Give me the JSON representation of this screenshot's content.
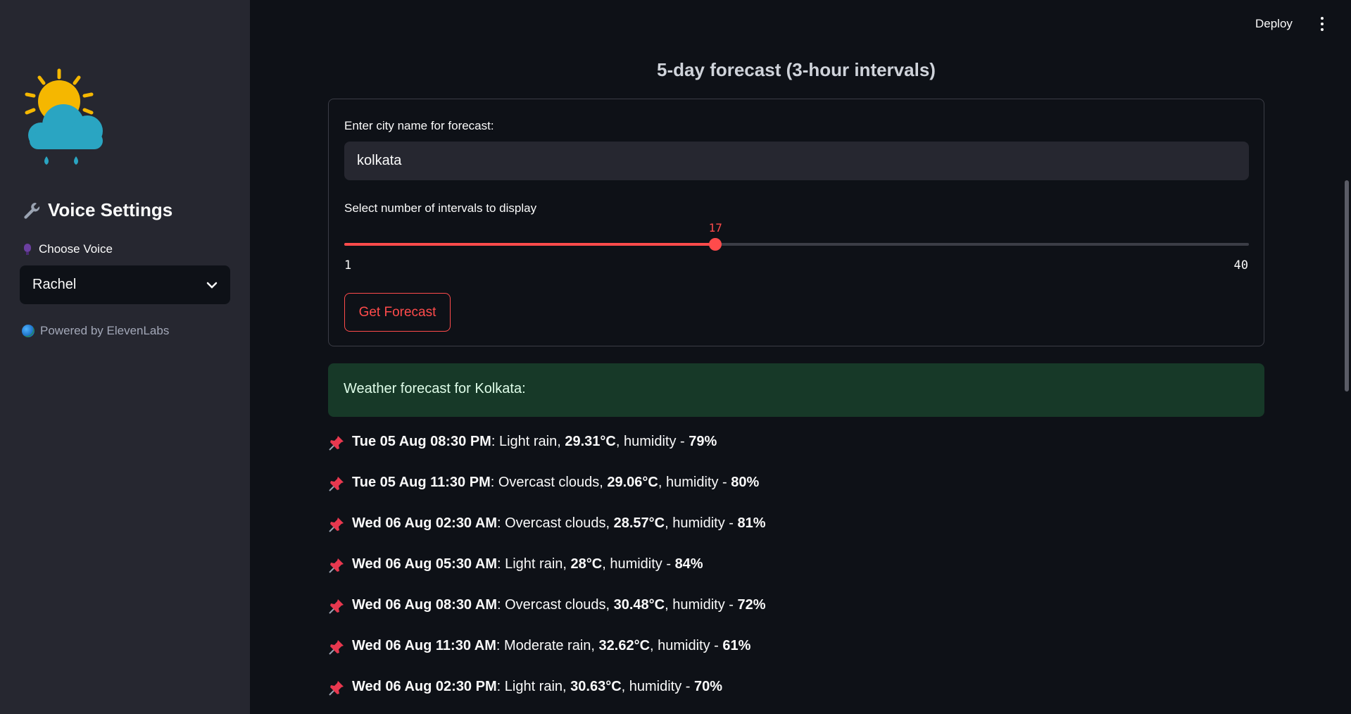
{
  "header": {
    "deploy_label": "Deploy",
    "menu_icon": "kebab-menu-icon"
  },
  "sidebar": {
    "logo_icon": "weather-rain-cloud-sun-icon",
    "heading": "Voice Settings",
    "heading_icon": "wrench-icon",
    "choose_voice_label": "Choose Voice",
    "choose_voice_icon": "microphone-icon",
    "voice_selected": "Rachel",
    "powered_by": "Powered by ElevenLabs",
    "powered_icon": "globe-icon"
  },
  "main": {
    "title": "5-day forecast (3-hour intervals)",
    "city_label": "Enter city name for forecast:",
    "city_value": "kolkata",
    "interval_label": "Select number of intervals to display",
    "interval_value": "17",
    "interval_min": "1",
    "interval_max": "40",
    "interval_fraction": 0.4103,
    "button_label": "Get Forecast",
    "success_message": "Weather forecast for Kolkata:",
    "pin_icon": "pushpin-icon",
    "forecast": [
      {
        "time": "Tue 05 Aug 08:30 PM",
        "desc": "Light rain",
        "temp": "29.31°C",
        "humidity": "79%"
      },
      {
        "time": "Tue 05 Aug 11:30 PM",
        "desc": "Overcast clouds",
        "temp": "29.06°C",
        "humidity": "80%"
      },
      {
        "time": "Wed 06 Aug 02:30 AM",
        "desc": "Overcast clouds",
        "temp": "28.57°C",
        "humidity": "81%"
      },
      {
        "time": "Wed 06 Aug 05:30 AM",
        "desc": "Light rain",
        "temp": "28°C",
        "humidity": "84%"
      },
      {
        "time": "Wed 06 Aug 08:30 AM",
        "desc": "Overcast clouds",
        "temp": "30.48°C",
        "humidity": "72%"
      },
      {
        "time": "Wed 06 Aug 11:30 AM",
        "desc": "Moderate rain",
        "temp": "32.62°C",
        "humidity": "61%"
      },
      {
        "time": "Wed 06 Aug 02:30 PM",
        "desc": "Light rain",
        "temp": "30.63°C",
        "humidity": "70%"
      }
    ]
  },
  "colors": {
    "accent": "#ff4b4b",
    "success_bg": "#173928",
    "sidebar_bg": "#262730",
    "app_bg": "#0e1117"
  }
}
